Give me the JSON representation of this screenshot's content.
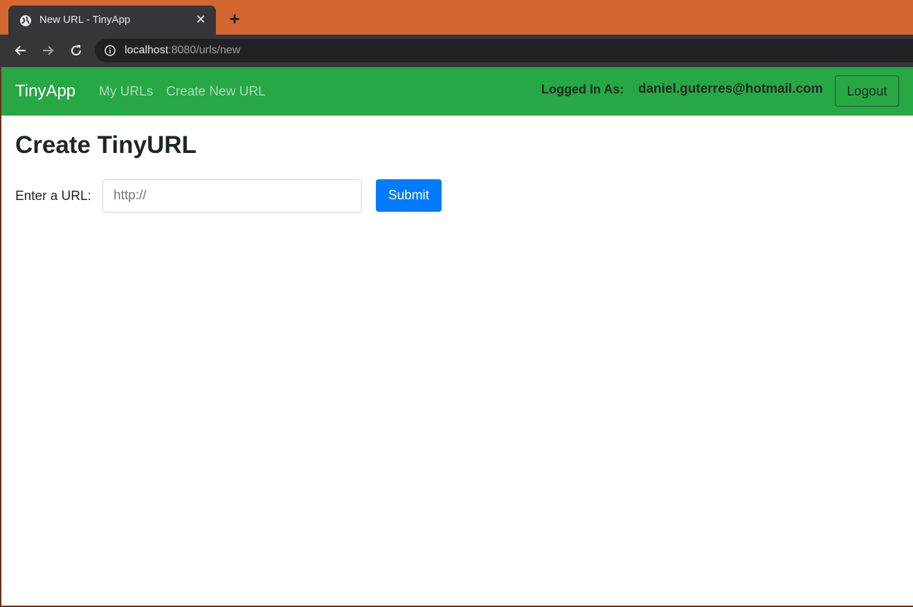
{
  "browser": {
    "tab_title": "New URL - TinyApp",
    "url_host": "localhost",
    "url_rest": ":8080/urls/new",
    "colors": {
      "tabstrip": "#d4672f",
      "toolbar": "#35363a"
    }
  },
  "navbar": {
    "brand": "TinyApp",
    "links": [
      "My URLs",
      "Create New URL"
    ],
    "logged_in_label": "Logged In As:",
    "user_email": "daniel.guterres@hotmail.com",
    "logout_label": "Logout",
    "color": "#28a745"
  },
  "main": {
    "title": "Create TinyURL",
    "form": {
      "label": "Enter a URL:",
      "placeholder": "http://",
      "submit_label": "Submit"
    }
  },
  "icons": [
    "globe-icon",
    "close-icon",
    "plus-icon",
    "back-arrow-icon",
    "forward-arrow-icon",
    "reload-icon",
    "info-icon"
  ]
}
